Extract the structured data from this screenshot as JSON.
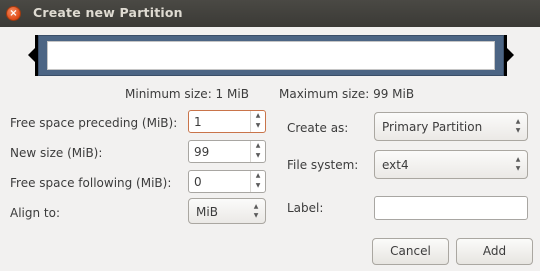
{
  "window": {
    "title": "Create new Partition",
    "close_glyph": "×"
  },
  "limits": {
    "minimum": "Minimum size: 1 MiB",
    "maximum": "Maximum size: 99 MiB"
  },
  "fields": {
    "free_preceding": {
      "label": "Free space preceding (MiB):",
      "value": "1"
    },
    "new_size": {
      "label": "New size (MiB):",
      "value": "99"
    },
    "free_following": {
      "label": "Free space following (MiB):",
      "value": "0"
    },
    "align_to": {
      "label": "Align to:",
      "value": "MiB"
    },
    "create_as": {
      "label": "Create as:",
      "value": "Primary Partition"
    },
    "file_system": {
      "label": "File system:",
      "value": "ext4"
    },
    "partition_label": {
      "label": "Label:",
      "value": ""
    }
  },
  "spin_arrows": {
    "up": "▲",
    "down": "▼"
  },
  "buttons": {
    "cancel": "Cancel",
    "add": "Add"
  },
  "colors": {
    "partition_bar": "#4c6584",
    "focus_border": "#c9744a",
    "close_button": "#df4a16"
  },
  "icons": {
    "close": "close-icon",
    "spin_up": "arrow-up-icon",
    "spin_down": "arrow-down-icon"
  }
}
